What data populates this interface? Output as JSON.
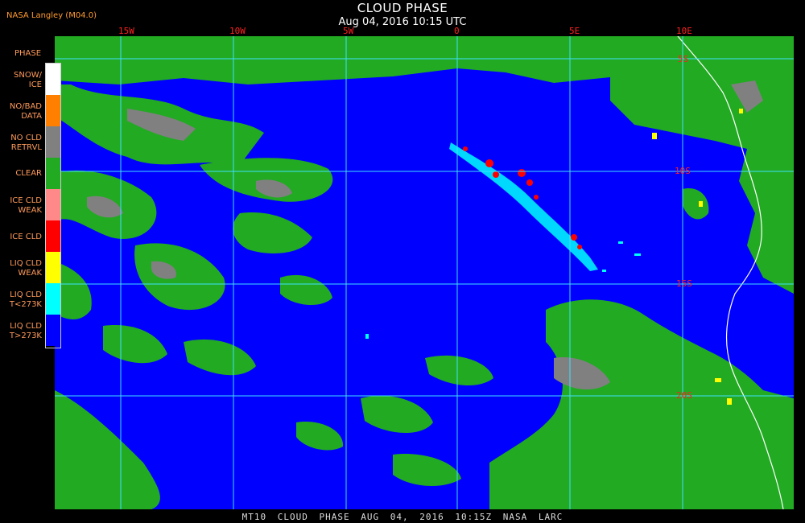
{
  "header": {
    "title": "CLOUD PHASE",
    "datetime": "Aug 04, 2016 10:15 UTC",
    "agency": "NASA Langley (M04.0)"
  },
  "legend": {
    "title": "PHASE",
    "items": [
      {
        "label": "SNOW/\nICE",
        "color": "#ffffff"
      },
      {
        "label": "NO/BAD\nDATA",
        "color": "#ff8000"
      },
      {
        "label": "NO CLD\nRETRVL",
        "color": "#808080"
      },
      {
        "label": "CLEAR",
        "color": "#22aa22"
      },
      {
        "label": "ICE CLD\nWEAK",
        "color": "#ff8888"
      },
      {
        "label": "ICE CLD",
        "color": "#ff0000"
      },
      {
        "label": "LIQ CLD\nWEAK",
        "color": "#ffff00"
      },
      {
        "label": "LIQ CLD\nT<273K",
        "color": "#00ffff"
      },
      {
        "label": "LIQ CLD\nT>273K",
        "color": "#0000ff"
      }
    ]
  },
  "grid": {
    "lon_labels": [
      "15W",
      "10W",
      "5W",
      "0",
      "5E",
      "10E"
    ],
    "lat_labels": [
      "5S",
      "10S",
      "15S",
      "20S"
    ],
    "color": "#40e0ff"
  },
  "footer": {
    "text": "MT10  CLOUD PHASE  AUG 04, 2016 10:15Z  NASA LARC"
  }
}
